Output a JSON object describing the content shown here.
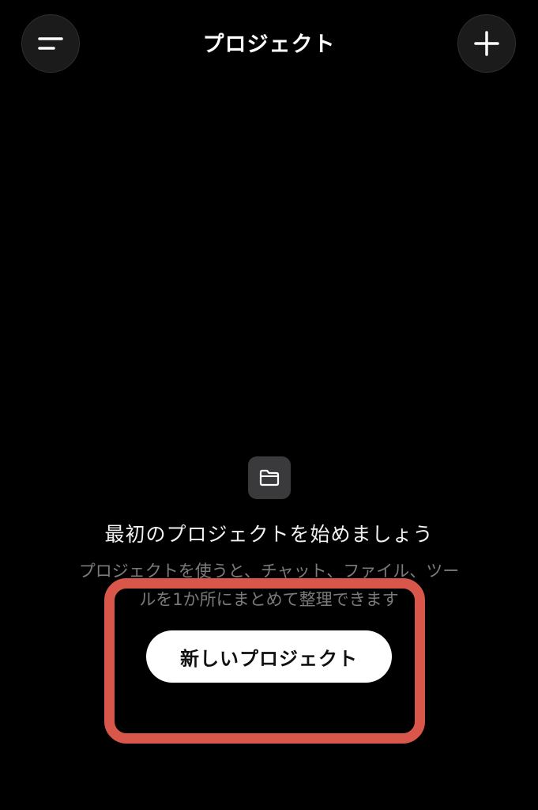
{
  "header": {
    "title": "プロジェクト",
    "menu_icon": "menu-icon",
    "add_icon": "plus-icon"
  },
  "empty_state": {
    "icon": "folder-icon",
    "title": "最初のプロジェクトを始めましょう",
    "description": "プロジェクトを使うと、チャット、ファイル、ツールを1か所にまとめて整理できます",
    "button_label": "新しいプロジェクト"
  },
  "colors": {
    "background": "#000000",
    "highlight": "#d9574a",
    "button_bg": "#ffffff"
  }
}
